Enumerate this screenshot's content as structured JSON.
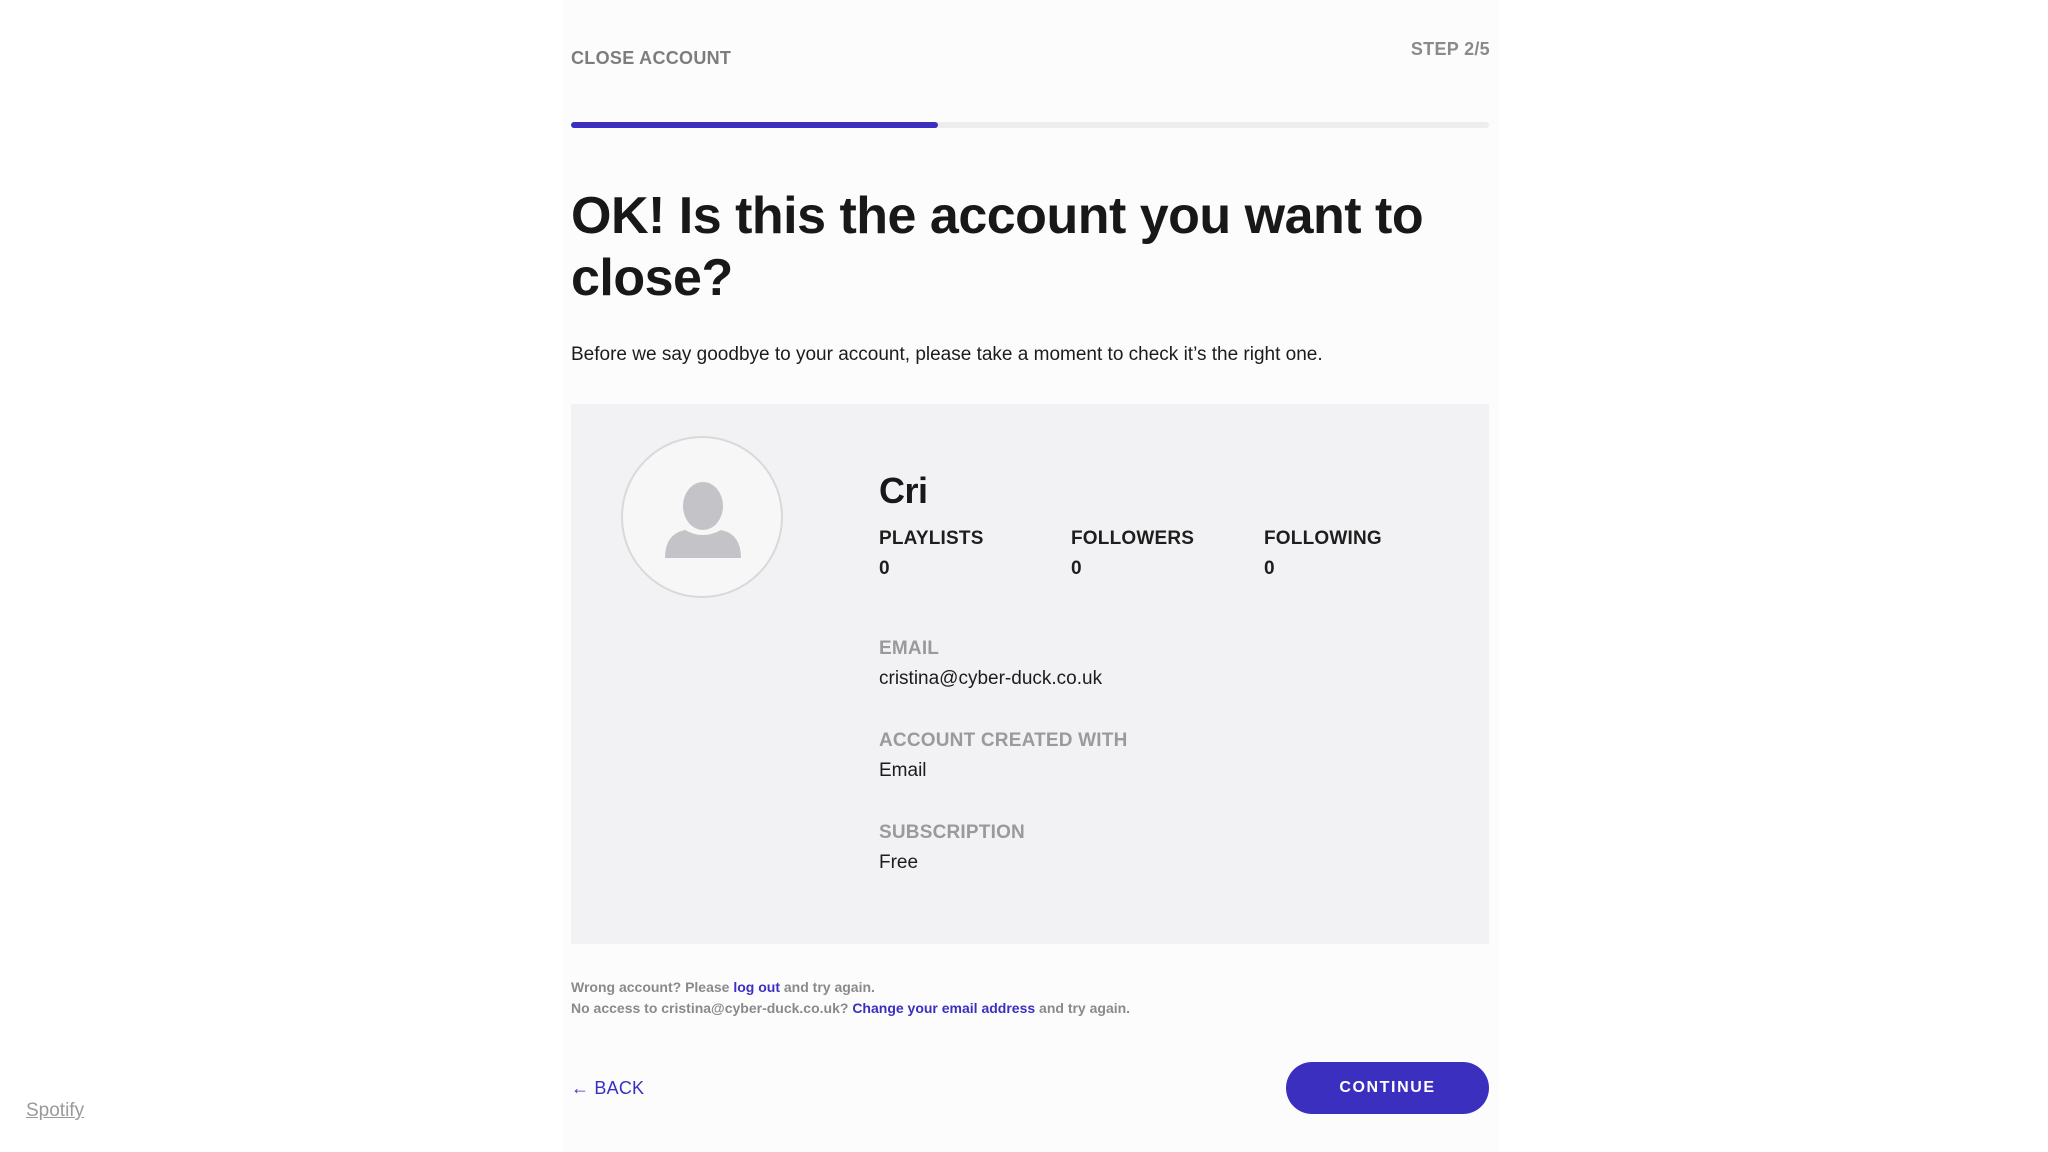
{
  "header": {
    "section_label": "CLOSE ACCOUNT",
    "step_label": "STEP 2/5",
    "progress_fraction": 0.4
  },
  "main": {
    "headline": "OK! Is this the account you want to close?",
    "intro": "Before we say goodbye to your account, please take a moment to check it’s the right one."
  },
  "account": {
    "avatar_icon": "user-silhouette-icon",
    "name": "Cri",
    "stats": [
      {
        "label": "PLAYLISTS",
        "value": "0"
      },
      {
        "label": "FOLLOWERS",
        "value": "0"
      },
      {
        "label": "FOLLOWING",
        "value": "0"
      }
    ],
    "fields": [
      {
        "label": "EMAIL",
        "value": "cristina@cyber-duck.co.uk"
      },
      {
        "label": "ACCOUNT CREATED WITH",
        "value": "Email"
      },
      {
        "label": "SUBSCRIPTION",
        "value": "Free"
      }
    ]
  },
  "help": {
    "line1_prefix": "Wrong account? Please",
    "line1_link": "log out",
    "line1_suffix": "and try again.",
    "line2_prefix": "No access to cristina@cyber-duck.co.uk?",
    "line2_link": "Change your email address",
    "line2_suffix": "and try again."
  },
  "navigation": {
    "back_label": "← BACK",
    "continue_label": "CONTINUE"
  },
  "footer": {
    "brand_link": "Spotify"
  },
  "colors": {
    "accent": "#3b2fc0",
    "card_background": "#f2f2f4",
    "muted_text": "#9a9a9a"
  }
}
